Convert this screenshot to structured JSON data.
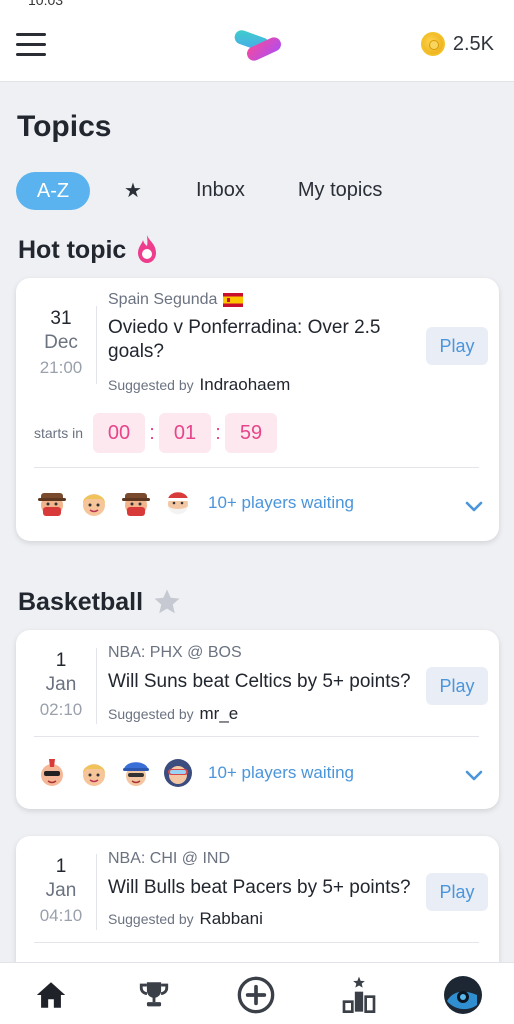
{
  "status_bar": {
    "time": "10:03"
  },
  "header": {
    "coins": "2.5K"
  },
  "page": {
    "title": "Topics"
  },
  "tabs": [
    {
      "label": "A-Z",
      "active": true
    },
    {
      "label": "★",
      "active": false
    },
    {
      "label": "Inbox",
      "active": false
    },
    {
      "label": "My topics",
      "active": false
    }
  ],
  "hot_topic": {
    "section_title": "Hot topic",
    "card": {
      "day": "31",
      "month": "Dec",
      "time": "21:00",
      "league": "Spain Segunda",
      "question": "Oviedo v Ponferradina: Over 2.5 goals?",
      "suggested_label": "Suggested by",
      "suggested_by": "Indraohaem",
      "play_label": "Play",
      "starts_in_label": "starts in",
      "countdown": {
        "h": "00",
        "m": "01",
        "s": "59"
      },
      "waiting": "10+ players waiting"
    }
  },
  "basketball": {
    "section_title": "Basketball",
    "cards": [
      {
        "day": "1",
        "month": "Jan",
        "time": "02:10",
        "league": "NBA: PHX @ BOS",
        "question": "Will Suns beat Celtics by 5+ points?",
        "suggested_label": "Suggested by",
        "suggested_by": "mr_e",
        "play_label": "Play",
        "waiting": "10+ players waiting"
      },
      {
        "day": "1",
        "month": "Jan",
        "time": "04:10",
        "league": "NBA: CHI @ IND",
        "question": "Will Bulls beat Pacers by 5+ points?",
        "suggested_label": "Suggested by",
        "suggested_by": "Rabbani",
        "play_label": "Play"
      }
    ]
  },
  "colors": {
    "accent": "#5ab3ef",
    "link": "#4a95db",
    "countdown": "#e8448a",
    "hot": "#ee3d8c"
  },
  "nav": [
    "home-icon",
    "trophy-icon",
    "add-circle-icon",
    "leaderboard-icon",
    "profile-avatar"
  ]
}
